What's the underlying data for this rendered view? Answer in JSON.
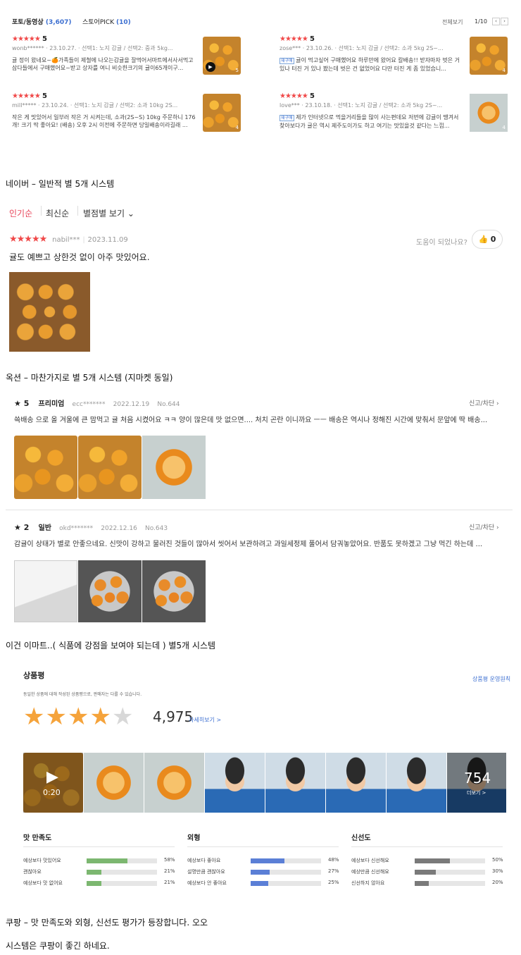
{
  "gmarket": {
    "tab_photo": "포토/동영상",
    "tab_photo_count": "(3,607)",
    "tab_pick": "스토어PICK",
    "tab_pick_count": "(10)",
    "view_all": "전체보기",
    "page": "1/10",
    "reviews": [
      {
        "stars": "★★★★★",
        "score": "5",
        "user": "wonb******",
        "date": "23.10.27.",
        "opts": "선택1: 노지 감귤 / 선택2: 중과 5kg...",
        "text": "귤 정이 왔네요~🍊가족들이 제철에 나오는감귤을 잘먹어서마트에서사서먹고삼다들에서 구매했어요~받고 상자를 여니 비슷한크기의 귤이65개이구...",
        "badge": "5"
      },
      {
        "stars": "★★★★★",
        "score": "5",
        "user": "zose***",
        "date": "23.10.26.",
        "opts": "선택1: 노지 감귤 / 선택2: 소과 5kg 2S~...",
        "tag": "재구매",
        "text": "귤이 먹고싶어 구매했어요 하루만에 왔어요 칼배송!! 받자마자 벗은 거 있나 터진 거 있나 봤는데 벗은 건 없었어요 다만 터진 게 좀 있었습니...",
        "badge": "4"
      },
      {
        "stars": "★★★★★",
        "score": "5",
        "user": "mill*****",
        "date": "23.10.24.",
        "opts": "선택1: 노지 감귤 / 선택2: 소과 10kg 2S...",
        "text": "작은 게 맛있어서 일부러 작은 거 시켜는데, 소과(2S~S) 10kg 주문하니 176개! 크기 딱 좋아요! (배송) 오후 2시 이전에 주문하면 당일배송이라길래 ...",
        "badge": "4"
      },
      {
        "stars": "★★★★★",
        "score": "5",
        "user": "love***",
        "date": "23.10.18.",
        "opts": "선택1: 노지 감귤 / 선택2: 소과 5kg 2S~...",
        "tag": "재구매",
        "text": "제가 인터넷으로 먹을거리들을 많이 사는편데요 저번에 감귤이 땡겨서 찾아보다가 귤은 역시 제주도이가도 하고 여기는 맛있을것 같다는 느낌...",
        "badge": "4"
      }
    ]
  },
  "caption1": "네이버 – 일반적 별 5개 시스템",
  "naver": {
    "sort_popular": "인기순",
    "sort_recent": "최신순",
    "sort_rating": "별점별 보기",
    "stars": "★★★★★",
    "user": "nabil***",
    "date": "2023.11.09",
    "helpful": "도움이 되었나요?",
    "helpful_count": "0",
    "text": "귤도 예쁘고 상한것 없이 아주 맛있어요."
  },
  "caption2": "옥션 – 마찬가지로 별 5개 시스템 (지마켓 동일)",
  "auction": {
    "reviews": [
      {
        "score": "★ 5",
        "grade": "프리미엄",
        "user": "ecc*******",
        "date": "2022.12.19",
        "no": "No.644",
        "report": "신고/차단",
        "text": "쓱배송 으로 올 겨울에 큰 맘먹고 귤 처음 시켰어요 ㅋㅋ 양이 많은데 맛 없으면.... 처치 곤란 이니까요 ㅡㅡ 배송은 역시나 정해진 시간에 맞춰서 문앞에 딱 배송..."
      },
      {
        "score": "★ 2",
        "grade": "일반",
        "user": "okd*******",
        "date": "2022.12.16",
        "no": "No.643",
        "report": "신고/차단",
        "text": "감귤이 상태가 별로 안좋으네요. 신맛이 강하고 물러진 것들이 많아서 씻어서 보관하려고 과일세정제 풀어서 담궈놓았어요. 반품도 못하겠고 그냥 먹긴 하는데 ..."
      }
    ]
  },
  "caption3": "이건 이마트..( 식품에 강점을 보여야 되는데 ) 별5개 시스템",
  "coupang": {
    "title": "상품평",
    "policy": "상품평 운영원칙",
    "desc": "동일한 상품에 대해 작성된 상품평으로, 판매자는 다를 수 있습니다.",
    "rating": 4,
    "count": "4,975",
    "detail": "자세히보기 >",
    "video_time": "0:20",
    "more_count": "754",
    "more_label": "더보기 >",
    "groups": [
      {
        "title": "맛 만족도",
        "color": "#7cb770",
        "rows": [
          {
            "label": "예상보다 맛있어요",
            "pct": 58,
            "pct_text": "58%"
          },
          {
            "label": "괜찮아요",
            "pct": 21,
            "pct_text": "21%"
          },
          {
            "label": "예상보다 맛 없어요",
            "pct": 21,
            "pct_text": "21%"
          }
        ]
      },
      {
        "title": "외형",
        "color": "#5b7fd6",
        "rows": [
          {
            "label": "예상보다 좋아요",
            "pct": 48,
            "pct_text": "48%"
          },
          {
            "label": "설명만큼 괜찮아요",
            "pct": 27,
            "pct_text": "27%"
          },
          {
            "label": "예상보다 안 좋아요",
            "pct": 25,
            "pct_text": "25%"
          }
        ]
      },
      {
        "title": "신선도",
        "color": "#7a7a7a",
        "rows": [
          {
            "label": "예상보다 신선해요",
            "pct": 50,
            "pct_text": "50%"
          },
          {
            "label": "예상만큼 신선해요",
            "pct": 30,
            "pct_text": "30%"
          },
          {
            "label": "신선하지 않아요",
            "pct": 20,
            "pct_text": "20%"
          }
        ]
      }
    ]
  },
  "caption4": "쿠팡 – 맛 만족도와 외형, 신선도 평가가 등장합니다. 오오",
  "caption5": "시스템은 쿠팡이 좋긴 하네요."
}
